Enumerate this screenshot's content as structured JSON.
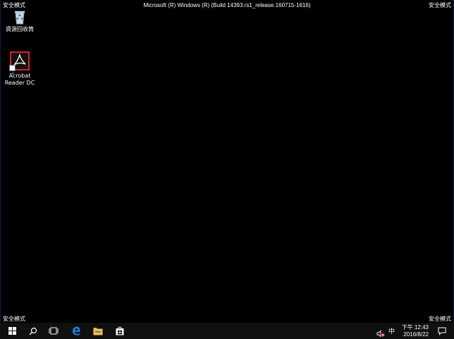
{
  "desktop": {
    "safe_mode_label": "安全模式",
    "build_text": "Microsoft (R) Windows (R) (Build 14393.rs1_release.160715-1616)",
    "icons": [
      {
        "label": "資源回收筒",
        "icon": "recycle-bin-icon"
      },
      {
        "label": "Acrobat Reader DC",
        "icon": "acrobat-reader-icon"
      }
    ]
  },
  "taskbar": {
    "buttons": [
      {
        "name": "start",
        "icon": "windows-logo-icon"
      },
      {
        "name": "search",
        "icon": "search-icon"
      },
      {
        "name": "task-view",
        "icon": "task-view-icon"
      },
      {
        "name": "edge",
        "icon": "edge-icon"
      },
      {
        "name": "file-explorer",
        "icon": "folder-icon"
      },
      {
        "name": "store",
        "icon": "store-icon"
      }
    ],
    "tray": {
      "ime": "中",
      "time": "下午 12:43",
      "date": "2016/8/22"
    }
  },
  "colors": {
    "desktop_bg": "#000000",
    "taskbar_bg": "#101010",
    "edge_blue": "#1e7fd6",
    "explorer_yellow": "#f2c14e",
    "acrobat_red": "#d8232a"
  }
}
